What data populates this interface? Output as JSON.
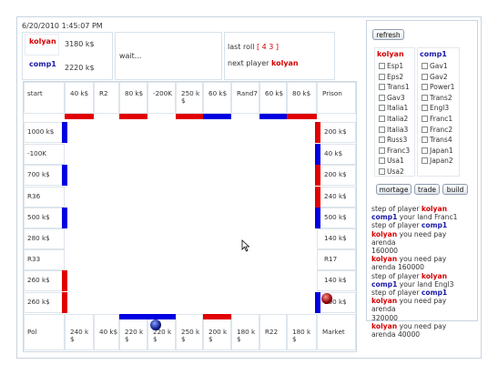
{
  "header": {
    "datetime": "6/20/2010 1:45:07 PM",
    "players": [
      {
        "name": "kolyan",
        "money": "3180 k$",
        "color": "#d40000"
      },
      {
        "name": "comp1",
        "money": "2220 k$",
        "color": "#1a1aa8"
      }
    ],
    "status": "wait...",
    "last_roll_label": "last roll",
    "last_roll_value": "[ 4 3 ]",
    "next_player_label": "next player",
    "next_player": "kolyan"
  },
  "board": {
    "top": [
      "start",
      "40 k$",
      "R2",
      "80 k$",
      "-200K",
      "250 k $",
      "60 k$",
      "Rand7",
      "60 k$",
      "80 k$",
      "Prison"
    ],
    "left": [
      "1000 k$",
      "-100K",
      "700 k$",
      "R36",
      "500 k$",
      "280 k$",
      "R33",
      "260 k$",
      "260 k$"
    ],
    "right": [
      "200 k$",
      "40 k$",
      "200 k$",
      "240 k$",
      "500 k$",
      "140 k$",
      "R17",
      "140 k$",
      "100 k$"
    ],
    "bottom": [
      "Pol",
      "240 k $",
      "40 k$",
      "220 k $",
      "220 k $",
      "250 k $",
      "200 k $",
      "180 k $",
      "R22",
      "180 k $",
      "Market"
    ]
  },
  "sidebar": {
    "refresh_label": "refresh",
    "col1_title": "kolyan",
    "col2_title": "comp1",
    "col1_items": [
      "Esp1",
      "Eps2",
      "Trans1",
      "Gav3",
      "Italia1",
      "Italia2",
      "Italia3",
      "Russ3",
      "Franc3",
      "Usa1",
      "Usa2"
    ],
    "col2_items": [
      "Gav1",
      "Gav2",
      "Power1",
      "Trans2",
      "Engl3",
      "Franc1",
      "Franc2",
      "Trans4",
      "Japan1",
      "Japan2"
    ],
    "buttons": {
      "mortage": "mortage",
      "trade": "trade",
      "build": "build"
    }
  },
  "log": [
    {
      "parts": [
        [
          "step of player ",
          ""
        ],
        [
          "kolyan",
          "red"
        ]
      ]
    },
    {
      "parts": [
        [
          "comp1",
          "blue"
        ],
        [
          "  your land Franc1",
          ""
        ]
      ]
    },
    {
      "parts": [
        [
          "step of player ",
          ""
        ],
        [
          "comp1",
          "blue"
        ]
      ]
    },
    {
      "parts": [
        [
          "kolyan",
          "red"
        ],
        [
          "  you need pay",
          ""
        ]
      ]
    },
    {
      "parts": [
        [
          "arenda",
          ""
        ]
      ]
    },
    {
      "parts": [
        [
          "160000",
          ""
        ]
      ]
    },
    {
      "parts": [
        [
          "kolyan",
          "red"
        ],
        [
          "  you need pay",
          ""
        ]
      ]
    },
    {
      "parts": [
        [
          "arenda 160000",
          ""
        ]
      ]
    },
    {
      "parts": [
        [
          "step of player ",
          ""
        ],
        [
          "kolyan",
          "red"
        ]
      ]
    },
    {
      "parts": [
        [
          "comp1",
          "blue"
        ],
        [
          "  your land Engl3",
          ""
        ]
      ]
    },
    {
      "parts": [
        [
          "step of player ",
          ""
        ],
        [
          "comp1",
          "blue"
        ]
      ]
    },
    {
      "parts": [
        [
          "kolyan",
          "red"
        ],
        [
          "  you need pay",
          ""
        ]
      ]
    },
    {
      "parts": [
        [
          "arenda",
          ""
        ]
      ]
    },
    {
      "parts": [
        [
          "320000",
          ""
        ]
      ]
    },
    {
      "parts": [
        [
          "kolyan",
          "red"
        ],
        [
          "  you need pay",
          ""
        ]
      ]
    },
    {
      "parts": [
        [
          "arenda 40000",
          ""
        ]
      ]
    }
  ],
  "owners": {
    "top": [
      "",
      "red",
      "",
      "red",
      "",
      "red",
      "blue",
      "",
      "blue",
      "red",
      ""
    ],
    "left": [
      "blue",
      "",
      "blue",
      "",
      "blue",
      "",
      "",
      "red",
      "red"
    ],
    "right": [
      "red",
      "blue",
      "red",
      "red",
      "blue",
      "",
      "",
      "",
      "blue"
    ],
    "bottom": [
      "",
      "",
      "",
      "blue",
      "blue",
      "",
      "red",
      "",
      "",
      "",
      ""
    ]
  },
  "colors": {
    "red": "#e00000",
    "blue": "#0000e0"
  }
}
